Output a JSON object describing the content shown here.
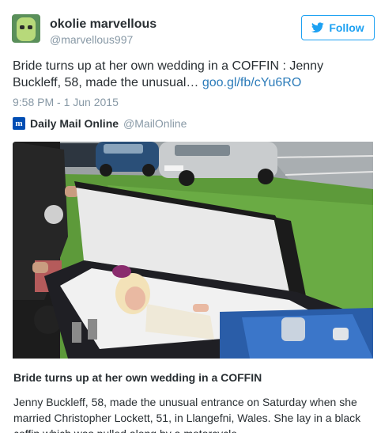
{
  "user": {
    "display_name": "okolie marvellous",
    "handle": "@marvellous997"
  },
  "follow_button": {
    "label": "Follow"
  },
  "tweet": {
    "text": "Bride turns up at her own wedding in a COFFIN : Jenny Buckleff, 58, made the unusual…",
    "link": "goo.gl/fb/cYu6RO",
    "timestamp": "9:58 PM - 1 Jun 2015"
  },
  "source": {
    "name": "Daily Mail Online",
    "handle": "@MailOnline"
  },
  "card": {
    "title": "Bride turns up at her own wedding in a COFFIN",
    "description": "Jenny Buckleff, 58, made the unusual entrance on Saturday when she married Christopher Lockett, 51, in Llangefni, Wales. She lay in a black coffin which was pulled along by a motorcycle."
  },
  "colors": {
    "accent": "#1da1f2",
    "link": "#2b7bb9",
    "muted": "#8899a6",
    "text": "#292f33"
  }
}
